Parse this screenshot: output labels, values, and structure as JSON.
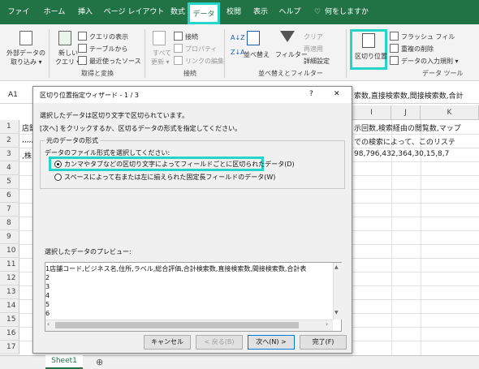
{
  "ribbon_tabs": [
    "ファイル",
    "ホーム",
    "挿入",
    "ページ レイアウト",
    "数式",
    "データ",
    "校閲",
    "表示",
    "ヘルプ",
    "何をしますか"
  ],
  "active_tab_index": 5,
  "ribbon": {
    "ext_data_line1": "外部データの",
    "ext_data_line2": "取り込み ▾",
    "new_query_line1": "新しい",
    "new_query_line2": "クエリ ▾",
    "show_query": "クエリの表示",
    "from_table": "テーブルから",
    "recent_sources": "最近使ったソース",
    "group_get_transform": "取得と変換",
    "refresh_all_line1": "すべて",
    "refresh_all_line2": "更新 ▾",
    "connections": "接続",
    "properties": "プロパティ",
    "edit_links": "リンクの編集",
    "group_connections": "接続",
    "sort": "並べ替え",
    "filter": "フィルター",
    "clear": "クリア",
    "reapply": "再適用",
    "advanced": "詳細設定",
    "group_sort_filter": "並べ替えとフィルター",
    "text_to_columns": "区切り位置",
    "flash_fill": "フラッシュ フィル",
    "remove_duplicates": "重複の削除",
    "data_validation": "データの入力規則 ▾",
    "group_data_tools": "データ ツール"
  },
  "namebox": "A1",
  "formula_text": "索数,直接検索数,間接検索数,合計",
  "columns": [
    "I",
    "J",
    "K"
  ],
  "rows": [
    "1",
    "2",
    "3",
    "4",
    "5",
    "6",
    "7",
    "8",
    "9",
    "10",
    "11",
    "12",
    "13",
    "14",
    "15",
    "16",
    "17"
  ],
  "cells": {
    "a1": "店舗",
    "a2": ",,,,,",
    "a3": ",株",
    "h1": "示回数,検索経由の閲覧数,マップ",
    "h2": "での検索によって、このリステ",
    "h3": "98,796,432,364,30,15,8,7"
  },
  "dialog": {
    "title": "区切り位置指定ウィザード - 1 / 3",
    "help": "?",
    "close": "✕",
    "desc1": "選択したデータは区切り文字で区切られています。",
    "desc2": "[次へ] をクリックするか、区切るデータの形式を指定してください。",
    "group_title": "元のデータの形式",
    "format_prompt": "データのファイル形式を選択してください:",
    "option_delimited": "カンマやタブなどの区切り文字によってフィールドごとに区切られたデータ(D)",
    "option_fixed": "スペースによって右または左に揃えられた固定長フィールドのデータ(W)",
    "preview_label": "選択したデータのプレビュー:",
    "preview_lines": [
      "1店舗コード,ビジネス名,住所,ラベル,総合評価,合計検索数,直接検索数,間接検索数,合計表",
      "2",
      "3",
      "4",
      "5",
      "6"
    ],
    "cancel": "キャンセル",
    "back": "< 戻る(B)",
    "next": "次へ(N) >",
    "finish": "完了(F)"
  },
  "sheet_tab": "Sheet1",
  "add_sheet": "⊕",
  "highlight_color": "#26d5c9",
  "excel_green": "#217346"
}
